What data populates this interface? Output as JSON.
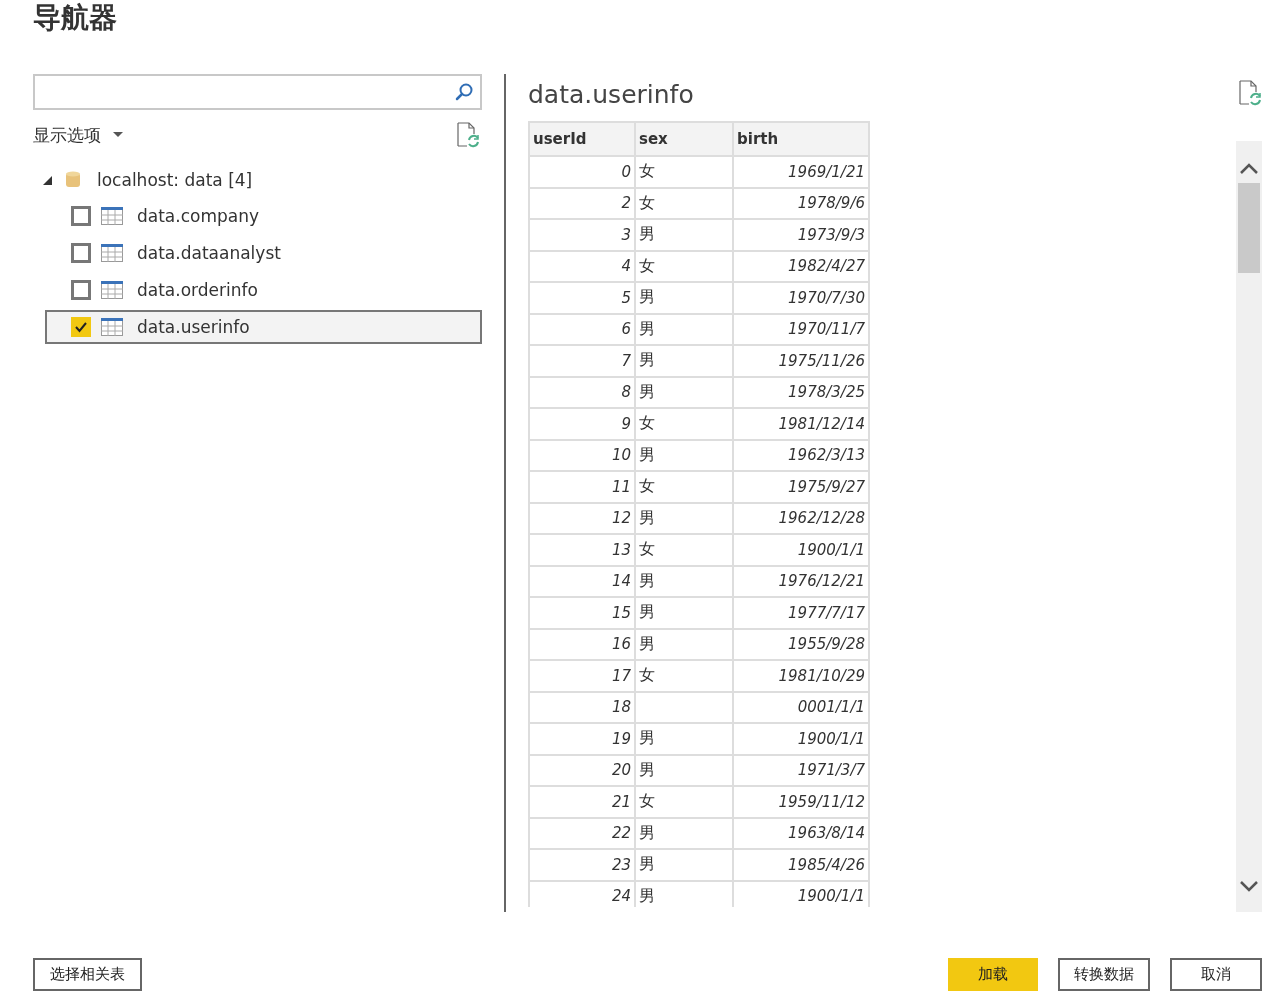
{
  "window": {
    "title": "导航器"
  },
  "display_options": {
    "label": "显示选项"
  },
  "tree": {
    "label": "localhost: data [4]",
    "expanded": true,
    "children": [
      {
        "label": "data.company",
        "checked": false,
        "selected": false
      },
      {
        "label": "data.dataanalyst",
        "checked": false,
        "selected": false
      },
      {
        "label": "data.orderinfo",
        "checked": false,
        "selected": false
      },
      {
        "label": "data.userinfo",
        "checked": true,
        "selected": true
      }
    ]
  },
  "preview": {
    "title": "data.userinfo",
    "columns": [
      "userId",
      "sex",
      "birth"
    ],
    "rows": [
      [
        "0",
        "女",
        "1969/1/21"
      ],
      [
        "2",
        "女",
        "1978/9/6"
      ],
      [
        "3",
        "男",
        "1973/9/3"
      ],
      [
        "4",
        "女",
        "1982/4/27"
      ],
      [
        "5",
        "男",
        "1970/7/30"
      ],
      [
        "6",
        "男",
        "1970/11/7"
      ],
      [
        "7",
        "男",
        "1975/11/26"
      ],
      [
        "8",
        "男",
        "1978/3/25"
      ],
      [
        "9",
        "女",
        "1981/12/14"
      ],
      [
        "10",
        "男",
        "1962/3/13"
      ],
      [
        "11",
        "女",
        "1975/9/27"
      ],
      [
        "12",
        "男",
        "1962/12/28"
      ],
      [
        "13",
        "女",
        "1900/1/1"
      ],
      [
        "14",
        "男",
        "1976/12/21"
      ],
      [
        "15",
        "男",
        "1977/7/17"
      ],
      [
        "16",
        "男",
        "1955/9/28"
      ],
      [
        "17",
        "女",
        "1981/10/29"
      ],
      [
        "18",
        null,
        "0001/1/1"
      ],
      [
        "19",
        "男",
        "1900/1/1"
      ],
      [
        "20",
        "男",
        "1971/3/7"
      ],
      [
        "21",
        "女",
        "1959/11/12"
      ],
      [
        "22",
        "男",
        "1963/8/14"
      ],
      [
        "23",
        "男",
        "1985/4/26"
      ],
      [
        "24",
        "男",
        "1900/1/1"
      ]
    ]
  },
  "buttons": [
    {
      "label": "选择相关表",
      "kind": "secondary"
    },
    {
      "label": "加载",
      "kind": "primary"
    },
    {
      "label": "转换数据",
      "kind": "secondary"
    },
    {
      "label": "取消",
      "kind": "secondary"
    }
  ]
}
